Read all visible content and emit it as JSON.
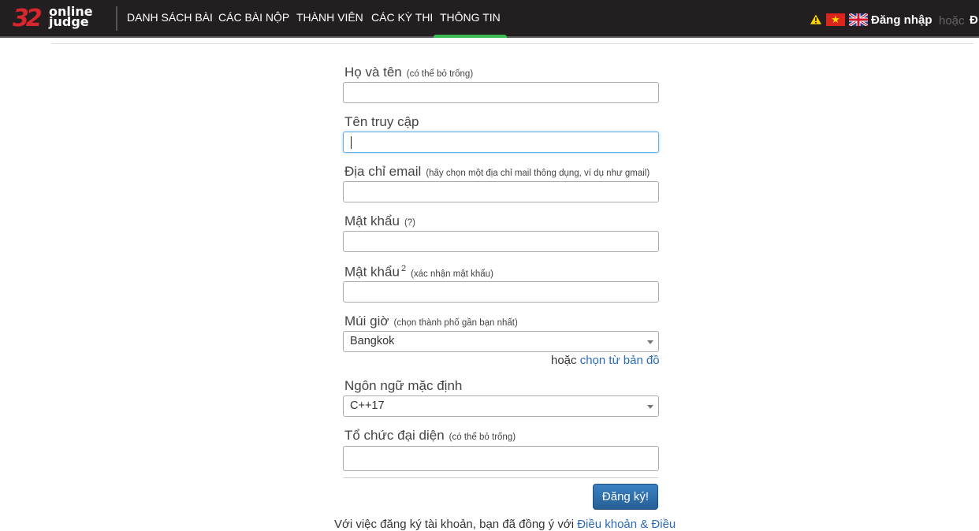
{
  "nav": {
    "logo_number": "32",
    "logo_line1": "online",
    "logo_line2": "judge",
    "items": [
      {
        "label": "DANH SÁCH BÀI"
      },
      {
        "label": "CÁC BÀI NỘP"
      },
      {
        "label": "THÀNH VIÊN"
      },
      {
        "label": "CÁC KỲ THI"
      },
      {
        "label": "THÔNG TIN",
        "active": true
      }
    ],
    "icons": [
      "warning-icon",
      "vietnam-flag-icon",
      "uk-flag-icon"
    ],
    "login": "Đăng nhập",
    "or": "hoặc",
    "register_cut": "Đ"
  },
  "form": {
    "fullname": {
      "label": "Họ và tên",
      "hint": "(có thể bỏ trống)",
      "value": ""
    },
    "username": {
      "label": "Tên truy cập",
      "value": ""
    },
    "email": {
      "label": "Địa chỉ email",
      "hint": "(hãy chọn một địa chỉ mail thông dụng, ví dụ như gmail)",
      "value": ""
    },
    "password": {
      "label": "Mật khẩu",
      "hint": "(?)",
      "value": ""
    },
    "password2": {
      "label": "Mật khẩu",
      "sup": "2",
      "hint": "(xác nhận mật khẩu)",
      "value": ""
    },
    "timezone": {
      "label": "Múi giờ",
      "hint": "(chọn thành phố gần bạn nhất)",
      "value": "Bangkok"
    },
    "map": {
      "prefix": "hoặc",
      "link": "chọn từ bản đồ"
    },
    "language": {
      "label": "Ngôn ngữ mặc định",
      "value": "C++17"
    },
    "organization": {
      "label": "Tổ chức đại diện",
      "hint": "(có thể bỏ trống)",
      "value": ""
    },
    "submit": "Đăng ký!",
    "terms_prefix": "Với việc đăng ký tài khoản, bạn đã đồng ý với",
    "terms_link": "Điều khoản & Điều"
  },
  "colors": {
    "nav_bg": "#231f20",
    "active_tab": "#3cba54",
    "link": "#2a6ab6",
    "button": "#2a6ca8"
  }
}
